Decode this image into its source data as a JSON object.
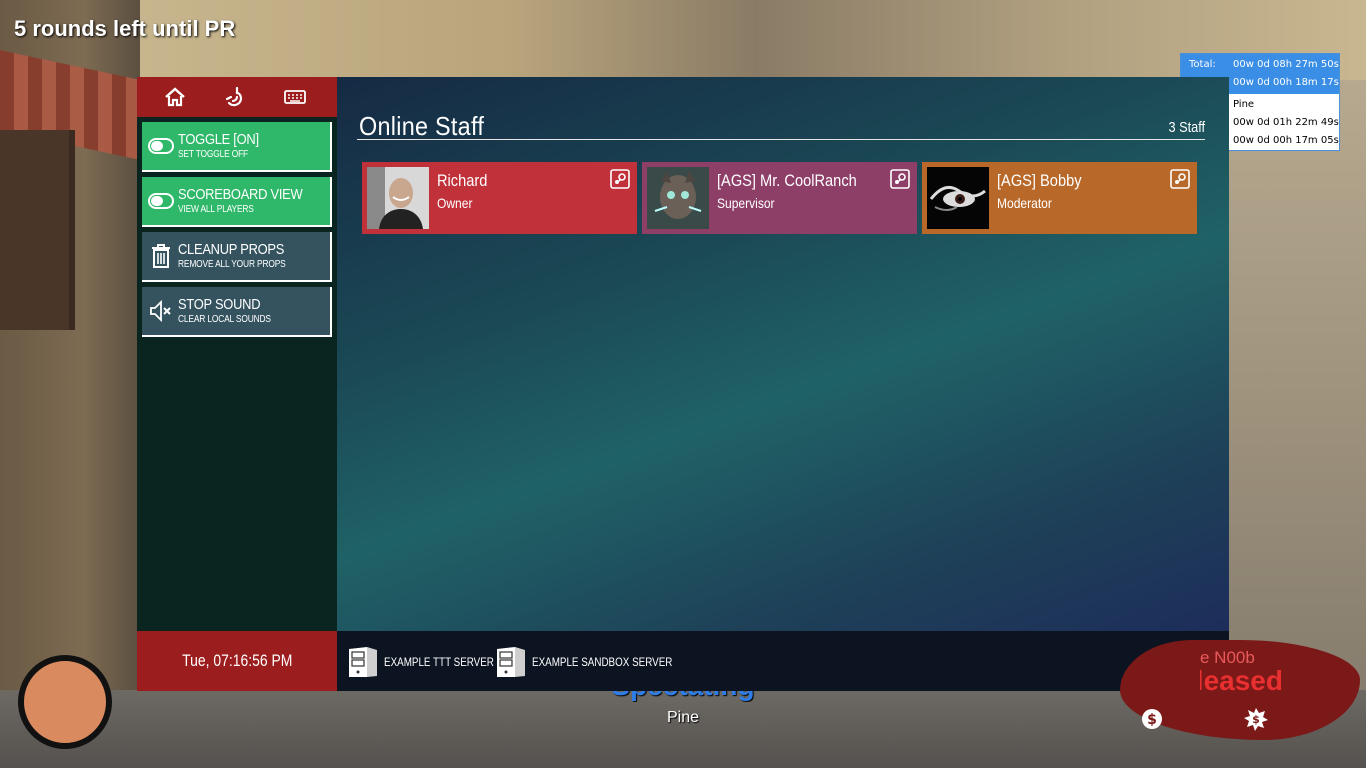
{
  "hud": {
    "rounds_text": "5 rounds left until PR",
    "spectating_label": "Spectating",
    "spectating_target": "Pine",
    "killer_text": "e N00b",
    "released_text": "Released"
  },
  "timer": {
    "total_label": "Total:",
    "total_value": "00w 0d 08h 27m 50s",
    "session_value": "00w 0d 00h 18m 17s",
    "player_name": "Pine",
    "player_total": "00w 0d 01h 22m 49s",
    "player_session": "00w 0d 00h 17m 05s"
  },
  "sidebar": {
    "top_icons": [
      "home-icon",
      "hand-icon",
      "keyboard-icon"
    ],
    "buttons": [
      {
        "title": "TOGGLE [ON]",
        "subtitle": "SET TOGGLE OFF",
        "icon": "toggle-icon",
        "color": "#2fb86a"
      },
      {
        "title": "SCOREBOARD VIEW",
        "subtitle": "VIEW ALL PLAYERS",
        "icon": "toggle-icon",
        "color": "#2fb86a"
      },
      {
        "title": "CLEANUP PROPS",
        "subtitle": "REMOVE ALL YOUR PROPS",
        "icon": "trash-icon",
        "color": "#34535f"
      },
      {
        "title": "STOP SOUND",
        "subtitle": "CLEAR LOCAL SOUNDS",
        "icon": "mute-icon",
        "color": "#34535f"
      }
    ],
    "datetime": "Tue, 07:16:56 PM"
  },
  "content": {
    "title": "Online Staff",
    "count": "3 Staff",
    "staff": [
      {
        "name": "Richard",
        "rank": "Owner",
        "color": "#c0313a"
      },
      {
        "name": "[AGS] Mr. CoolRanch",
        "rank": "Supervisor",
        "color": "#8e3f68"
      },
      {
        "name": "[AGS] Bobby",
        "rank": "Moderator",
        "color": "#b8692a"
      }
    ]
  },
  "footer": {
    "servers": [
      {
        "label": "EXAMPLE TTT SERVER"
      },
      {
        "label": "EXAMPLE SANDBOX SERVER"
      }
    ]
  }
}
